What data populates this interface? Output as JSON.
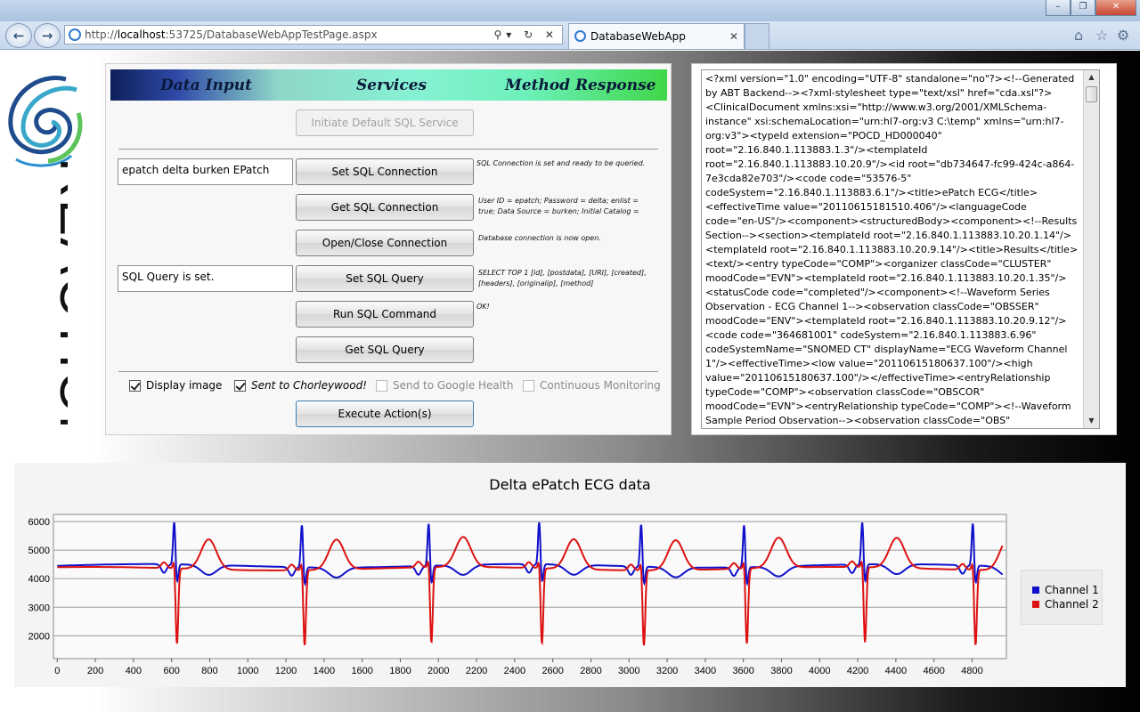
{
  "browser": {
    "address_host": "localhost",
    "address_rest": ":53725/DatabaseWebAppTestPage.aspx",
    "address_prefix": "http://",
    "tab_title": "DatabaseWebApp"
  },
  "logo": {
    "text": "REACTION"
  },
  "banner": {
    "left": "Data Input",
    "center": "Services",
    "right": "Method Response"
  },
  "buttons": {
    "initiate": "Initiate Default SQL Service",
    "set_conn": "Set SQL Connection",
    "get_conn": "Get SQL Connection",
    "open_close": "Open/Close Connection",
    "set_query": "Set SQL Query",
    "run_cmd": "Run SQL Command",
    "get_query": "Get SQL Query",
    "execute": "Execute Action(s)"
  },
  "inputs": {
    "connection": "epatch delta burken EPatch",
    "query": "SQL Query is set."
  },
  "responses": {
    "set_conn": "SQL Connection is set and ready to be queried.",
    "get_conn": "User ID = epatch; Password = delta; enlist = true; Data Source = burken; Initial Catalog =",
    "open_close": "Database connection is now open.",
    "set_query": "SELECT TOP 1 [id], [postdata], [URI], [created], [headers], [originalip], [method]",
    "run_cmd": "OK!"
  },
  "checkboxes": [
    {
      "label": "Display image",
      "checked": true,
      "enabled": true
    },
    {
      "label": "Sent to Chorleywood!",
      "checked": true,
      "enabled": true
    },
    {
      "label": "Send to Google Health",
      "checked": false,
      "enabled": false
    },
    {
      "label": "Continuous Monitoring",
      "checked": false,
      "enabled": false
    }
  ],
  "xml_output": "<?xml version=\"1.0\" encoding=\"UTF-8\" standalone=\"no\"?><!--Generated by ABT Backend--><?xml-stylesheet type=\"text/xsl\" href=\"cda.xsl\"?><ClinicalDocument xmlns:xsi=\"http://www.w3.org/2001/XMLSchema-instance\" xsi:schemaLocation=\"urn:hl7-org:v3 C:\\temp\" xmlns=\"urn:hl7-org:v3\"><typeId extension=\"POCD_HD000040\" root=\"2.16.840.1.113883.1.3\"/><templateId root=\"2.16.840.1.113883.10.20.9\"/><id root=\"db734647-fc99-424c-a864-7e3cda82e703\"/><code code=\"53576-5\" codeSystem=\"2.16.840.1.113883.6.1\"/><title>ePatch ECG</title><effectiveTime value=\"20110615181510.406\"/><languageCode code=\"en-US\"/><component><structuredBody><component><!--Results Section--><section><templateId root=\"2.16.840.1.113883.10.20.1.14\"/><templateId root=\"2.16.840.1.113883.10.20.9.14\"/><title>Results</title><text/><entry typeCode=\"COMP\"><organizer classCode=\"CLUSTER\" moodCode=\"EVN\"><templateId root=\"2.16.840.1.113883.10.20.1.35\"/><statusCode code=\"completed\"/><component><!--Waveform Series Observation - ECG Channel 1--><observation classCode=\"OBSSER\" moodCode=\"ENV\"><templateId root=\"2.16.840.1.113883.10.20.9.12\"/><code code=\"364681001\" codeSystem=\"2.16.840.1.113883.6.96\" codeSystemName=\"SNOMED CT\" displayName=\"ECG Waveform Channel 1\"/><effectiveTime><low value=\"20110615180637.100\"/><high value=\"20110615180637.100\"/></effectiveTime><entryRelationship typeCode=\"COMP\"><observation classCode=\"OBSCOR\" moodCode=\"EVN\"><entryRelationship typeCode=\"COMP\"><!--Waveform Sample Period Observation--><observation classCode=\"OBS\"",
  "chart_data": {
    "type": "line",
    "title": "Delta ePatch ECG data",
    "xlabel": "",
    "ylabel": "",
    "xlim": [
      -20,
      4980
    ],
    "ylim": [
      1200,
      6250
    ],
    "xticks": [
      0,
      200,
      400,
      600,
      800,
      1000,
      1200,
      1400,
      1600,
      1800,
      2000,
      2200,
      2400,
      2600,
      2800,
      3000,
      3200,
      3400,
      3600,
      3800,
      4000,
      4200,
      4400,
      4600,
      4800
    ],
    "yticks": [
      2000,
      3000,
      4000,
      5000,
      6000
    ],
    "grid": "horizontal",
    "legend": "right",
    "beats": [
      620,
      1290,
      1955,
      2535,
      3070,
      3610,
      4230,
      4810
    ],
    "series": [
      {
        "name": "Channel 1",
        "color": "#1111cc",
        "baseline": 4450,
        "r_peak": 6000,
        "s_trough": 3800,
        "t_peak": 4100
      },
      {
        "name": "Channel 2",
        "color": "#dd1111",
        "baseline": 4350,
        "r_peak": 4700,
        "s_trough": 1700,
        "t_peak": 5400
      }
    ]
  }
}
